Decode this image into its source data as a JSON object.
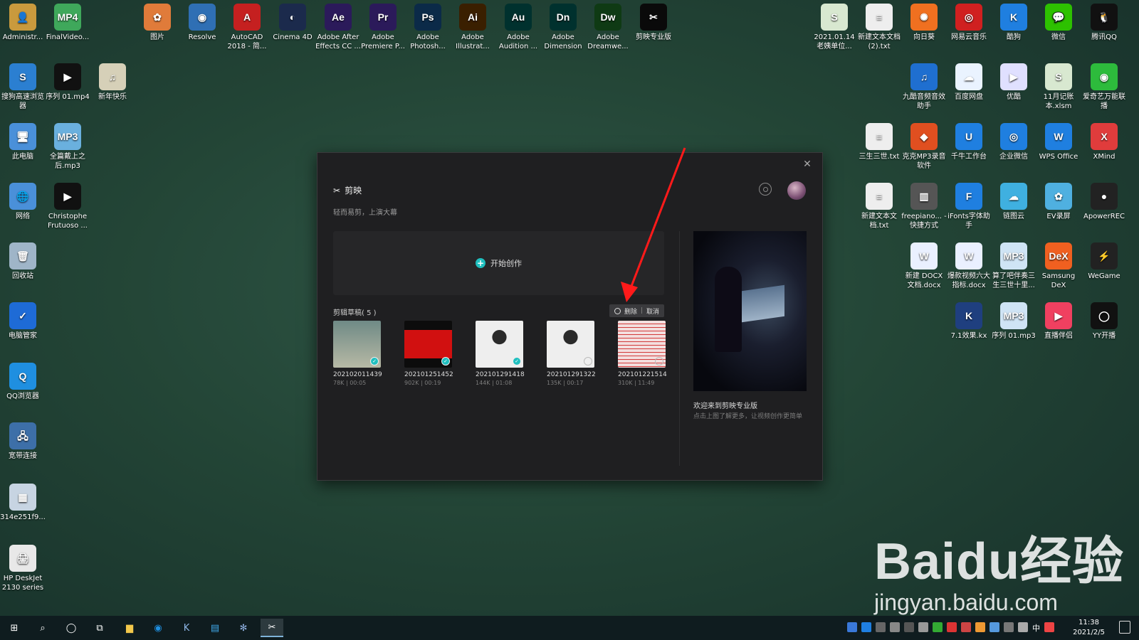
{
  "desktop_icons_top": [
    {
      "label": "Administr...",
      "color": "#c99a3d",
      "glyph": "👤"
    },
    {
      "label": "FinalVideo...",
      "color": "#3fa85b",
      "glyph": "MP4"
    },
    {
      "label": "图片",
      "color": "#e07b3a",
      "glyph": "✿"
    },
    {
      "label": "Resolve",
      "color": "#2f6fb4",
      "glyph": "◉"
    },
    {
      "label": "AutoCAD 2018 - 简...",
      "color": "#c52020",
      "glyph": "A"
    },
    {
      "label": "Cinema 4D",
      "color": "#1b2a4c",
      "glyph": "◐"
    },
    {
      "label": "Adobe After Effects CC ...",
      "color": "#2b1a5a",
      "glyph": "Ae"
    },
    {
      "label": "Adobe Premiere P...",
      "color": "#2b1a5a",
      "glyph": "Pr"
    },
    {
      "label": "Adobe Photosh...",
      "color": "#0b2a48",
      "glyph": "Ps"
    },
    {
      "label": "Adobe Illustrat...",
      "color": "#3a1f00",
      "glyph": "Ai"
    },
    {
      "label": "Adobe Audition ...",
      "color": "#00312e",
      "glyph": "Au"
    },
    {
      "label": "Adobe Dimension",
      "color": "#00312e",
      "glyph": "Dn"
    },
    {
      "label": "Adobe Dreamwe...",
      "color": "#0f3a14",
      "glyph": "Dw"
    },
    {
      "label": "剪映专业版",
      "color": "#0a0a0a",
      "glyph": "✂"
    }
  ],
  "desktop_icons_left": [
    {
      "label": "搜狗高速浏览器",
      "color": "#2b7fd1",
      "glyph": "S"
    },
    {
      "label": "序列 01.mp4",
      "color": "#111",
      "glyph": "▶"
    },
    {
      "label": "新年快乐",
      "color": "#d6d0b8",
      "glyph": "♫"
    },
    {
      "label": "此电脑",
      "color": "#4a90d9",
      "glyph": "🖥"
    },
    {
      "label": "全篇戴上之后.mp3",
      "color": "#6ab0de",
      "glyph": "MP3"
    },
    {
      "label": "网络",
      "color": "#4a90d9",
      "glyph": "🌐"
    },
    {
      "label": "Christophe Frutuoso ...",
      "color": "#111",
      "glyph": "▶"
    },
    {
      "label": "回收站",
      "color": "#9fb5c8",
      "glyph": "🗑"
    },
    {
      "label": "电脑管家",
      "color": "#1e6bd6",
      "glyph": "✓"
    },
    {
      "label": "QQ浏览器",
      "color": "#1f8fe0",
      "glyph": "Q"
    },
    {
      "label": "宽带连接",
      "color": "#3d6fa8",
      "glyph": "🖧"
    },
    {
      "label": "314e251f9...",
      "color": "#c7d4e2",
      "glyph": "▦"
    },
    {
      "label": "HP DeskJet 2130 series",
      "color": "#e8e8e8",
      "glyph": "🖨"
    }
  ],
  "desktop_icons_right": [
    {
      "label": "2021.01.14 老姨单位...",
      "color": "#d8e8d0",
      "glyph": "S"
    },
    {
      "label": "新建文本文档 (2).txt",
      "color": "#eee",
      "glyph": "≡"
    },
    {
      "label": "向日葵",
      "color": "#f07020",
      "glyph": "✺"
    },
    {
      "label": "网易云音乐",
      "color": "#d02020",
      "glyph": "◎"
    },
    {
      "label": "酷狗",
      "color": "#1f7fe0",
      "glyph": "K"
    },
    {
      "label": "微信",
      "color": "#2dc100",
      "glyph": "💬"
    },
    {
      "label": "腾讯QQ",
      "color": "#111",
      "glyph": "🐧"
    },
    {
      "label": "九酷音频音效助手",
      "color": "#1f6fd0",
      "glyph": "♫"
    },
    {
      "label": "百度网盘",
      "color": "#eaf3ff",
      "glyph": "☁"
    },
    {
      "label": "优酷",
      "color": "#e0e0ff",
      "glyph": "▶"
    },
    {
      "label": "11月记账本.xlsm",
      "color": "#d8e8d0",
      "glyph": "S"
    },
    {
      "label": "爱奇艺万能联播",
      "color": "#2dbb3c",
      "glyph": "◉"
    },
    {
      "label": "三生三世.txt",
      "color": "#eee",
      "glyph": "≡"
    },
    {
      "label": "克克MP3录音软件",
      "color": "#e04f20",
      "glyph": "◆"
    },
    {
      "label": "千牛工作台",
      "color": "#1f7fe0",
      "glyph": "U"
    },
    {
      "label": "企业微信",
      "color": "#1f7fe0",
      "glyph": "◎"
    },
    {
      "label": "WPS Office",
      "color": "#1f7fe0",
      "glyph": "W"
    },
    {
      "label": "XMind",
      "color": "#e03c3c",
      "glyph": "X"
    },
    {
      "label": "新建文本文档.txt",
      "color": "#eee",
      "glyph": "≡"
    },
    {
      "label": "freepiano... - 快捷方式",
      "color": "#555",
      "glyph": "▥"
    },
    {
      "label": "iFonts字体助手",
      "color": "#1f7fe0",
      "glyph": "F"
    },
    {
      "label": "链图云",
      "color": "#3fb0e0",
      "glyph": "☁"
    },
    {
      "label": "EV录屏",
      "color": "#4fb0e0",
      "glyph": "✿"
    },
    {
      "label": "ApowerREC",
      "color": "#222",
      "glyph": "●"
    },
    {
      "label": "新建 DOCX 文档.docx",
      "color": "#eaf0ff",
      "glyph": "W"
    },
    {
      "label": "爆款视频六大指标.docx",
      "color": "#eaf0ff",
      "glyph": "W"
    },
    {
      "label": "算了吧伴奏三生三世十里...",
      "color": "#cfe4f5",
      "glyph": "MP3"
    },
    {
      "label": "Samsung DeX",
      "color": "#f06020",
      "glyph": "DeX"
    },
    {
      "label": "WeGame",
      "color": "#222",
      "glyph": "⚡"
    },
    {
      "label": "7.1效果.kx",
      "color": "#1f3f7f",
      "glyph": "K"
    },
    {
      "label": "序列 01.mp3",
      "color": "#cfe4f5",
      "glyph": "MP3"
    },
    {
      "label": "直播伴侣",
      "color": "#f04060",
      "glyph": "▶"
    },
    {
      "label": "YY开播",
      "color": "#111",
      "glyph": "◯"
    }
  ],
  "dialog": {
    "brand": "剪映",
    "tagline": "轻而易剪，上演大幕",
    "create_label": "开始创作",
    "drafts_title": "剪辑草稿( 5 )",
    "delete_label": "删除",
    "separator": "|",
    "cancel_label": "取消",
    "drafts": [
      {
        "name": "202102011439",
        "meta": "78K | 00:05",
        "checked": true,
        "bg": "linear-gradient(#6f8a86,#b7b9a5)"
      },
      {
        "name": "202101251452",
        "meta": "902K | 00:19",
        "checked": true,
        "bg": "linear-gradient(#0c0c0c 0%,#0c0c0c 20%,#d11010 20%,#d11010 80%,#0c0c0c 80%)"
      },
      {
        "name": "202101291418",
        "meta": "144K | 01:08",
        "checked": true,
        "bg": "radial-gradient(circle at 50% 35%,#2a2a2a 18%,#eeeeee 19%)"
      },
      {
        "name": "202101291322",
        "meta": "135K | 00:17",
        "checked": false,
        "bg": "radial-gradient(circle at 50% 35%,#2a2a2a 18%,#eeeeee 19%)"
      },
      {
        "name": "202101221514",
        "meta": "310K | 11:49",
        "checked": false,
        "bg": "repeating-linear-gradient(#f3dede 0 4px,#d23a3a 4px 5px)"
      }
    ],
    "promo_title": "欢迎来到剪映专业版",
    "promo_desc": "点击上图了解更多，让视频创作更简单"
  },
  "taskbar": {
    "time": "11:38",
    "date": "2021/2/5",
    "ime": "中"
  },
  "watermark": {
    "top": "Baidu经验",
    "bottom": "jingyan.baidu.com"
  }
}
